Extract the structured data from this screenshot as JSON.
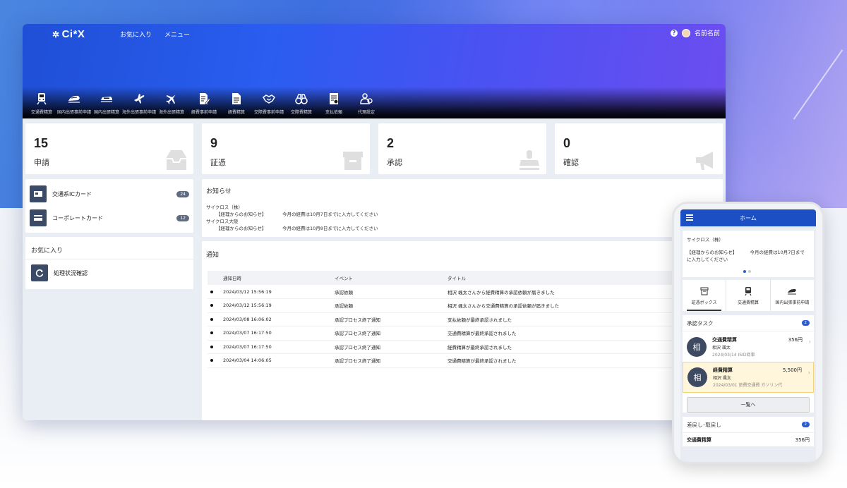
{
  "app": {
    "logo": "Ci*X"
  },
  "topnav": {
    "favorites": "お気に入り",
    "menu": "メニュー"
  },
  "user": {
    "name": "名前名前",
    "help": "?"
  },
  "menubar": [
    {
      "label": "交通費精算",
      "icon": "train-icon"
    },
    {
      "label": "国内出張事前申請",
      "icon": "shinkansen-icon"
    },
    {
      "label": "国内出張精算",
      "icon": "bullet-train-icon"
    },
    {
      "label": "海外出張事前申請",
      "icon": "plane-departure-icon"
    },
    {
      "label": "海外出張精算",
      "icon": "plane-icon"
    },
    {
      "label": "経費事前申請",
      "icon": "doc-edit-icon"
    },
    {
      "label": "経費精算",
      "icon": "document-icon"
    },
    {
      "label": "交際費事前申請",
      "icon": "handshake-icon"
    },
    {
      "label": "交際費精算",
      "icon": "binoculars-icon"
    },
    {
      "label": "支払依頼",
      "icon": "invoice-icon"
    },
    {
      "label": "代理設定",
      "icon": "users-icon"
    }
  ],
  "stats": [
    {
      "value": "15",
      "label": "申請",
      "icon": "inbox-icon"
    },
    {
      "value": "9",
      "label": "証憑",
      "icon": "box-icon"
    },
    {
      "value": "2",
      "label": "承認",
      "icon": "stamp-icon"
    },
    {
      "value": "0",
      "label": "確認",
      "icon": "megaphone-icon"
    }
  ],
  "cards": [
    {
      "label": "交通系ICカード",
      "count": "24"
    },
    {
      "label": "コーポレートカード",
      "count": "12"
    }
  ],
  "favorites": {
    "title": "お気に入り",
    "items": [
      {
        "label": "処理状況確認"
      }
    ]
  },
  "notice": {
    "title": "お知らせ",
    "entries": [
      {
        "company": "サイクロス（株）",
        "tag": "【経理からのお知らせ】",
        "text": "今月の経費は10月7日までに入力してください"
      },
      {
        "company": "サイクロス大阪",
        "tag": "【経理からのお知らせ】",
        "text": "今月の経費は10月8日までに入力してください"
      }
    ]
  },
  "notifications": {
    "title": "通知",
    "columns": [
      "通知日時",
      "イベント",
      "タイトル"
    ],
    "rows": [
      {
        "date": "2024/03/12 15:56:19",
        "event": "承認依頼",
        "title": "相沢 颯太さんから経費精算の承認依頼が届きました"
      },
      {
        "date": "2024/03/12 15:56:19",
        "event": "承認依頼",
        "title": "相沢 颯太さんから交通費精算の承認依頼が届きました"
      },
      {
        "date": "2024/03/08 16:06:02",
        "event": "承認プロセス終了通知",
        "title": "支払依頼が最終承認されました"
      },
      {
        "date": "2024/03/07 16:17:50",
        "event": "承認プロセス終了通知",
        "title": "交通費精算が最終承認されました"
      },
      {
        "date": "2024/03/07 16:17:50",
        "event": "承認プロセス終了通知",
        "title": "経費精算が最終承認されました"
      },
      {
        "date": "2024/03/04 14:06:05",
        "event": "承認プロセス終了通知",
        "title": "交通費精算が最終承認されました"
      }
    ]
  },
  "phone": {
    "title": "ホーム",
    "notice": {
      "company": "サイクロス（株）",
      "tag": "【経理からのお知らせ】",
      "text": "今月の経費は10月7日まで",
      "text2": "に入力してください"
    },
    "tabs": [
      {
        "label": "証憑ボックス",
        "icon": "box-icon"
      },
      {
        "label": "交通費精算",
        "icon": "train-icon"
      },
      {
        "label": "国内出張事前申請",
        "icon": "shinkansen-icon"
      }
    ],
    "approval": {
      "title": "承認タスク",
      "count": "2",
      "tasks": [
        {
          "avatar": "相",
          "type": "交通費精算",
          "amount": "356円",
          "name": "相沢 颯太",
          "detail": "2024/03/14 ISID商事"
        },
        {
          "avatar": "相",
          "type": "経費精算",
          "amount": "5,500円",
          "name": "相沢 颯太",
          "detail": "2024/03/01 旅費交通費 ガソリン代"
        }
      ],
      "more": "一覧へ"
    },
    "returned": {
      "title": "差戻し･取戻し",
      "count": "2",
      "row_type": "交通費精算",
      "row_amount": "356円"
    }
  }
}
